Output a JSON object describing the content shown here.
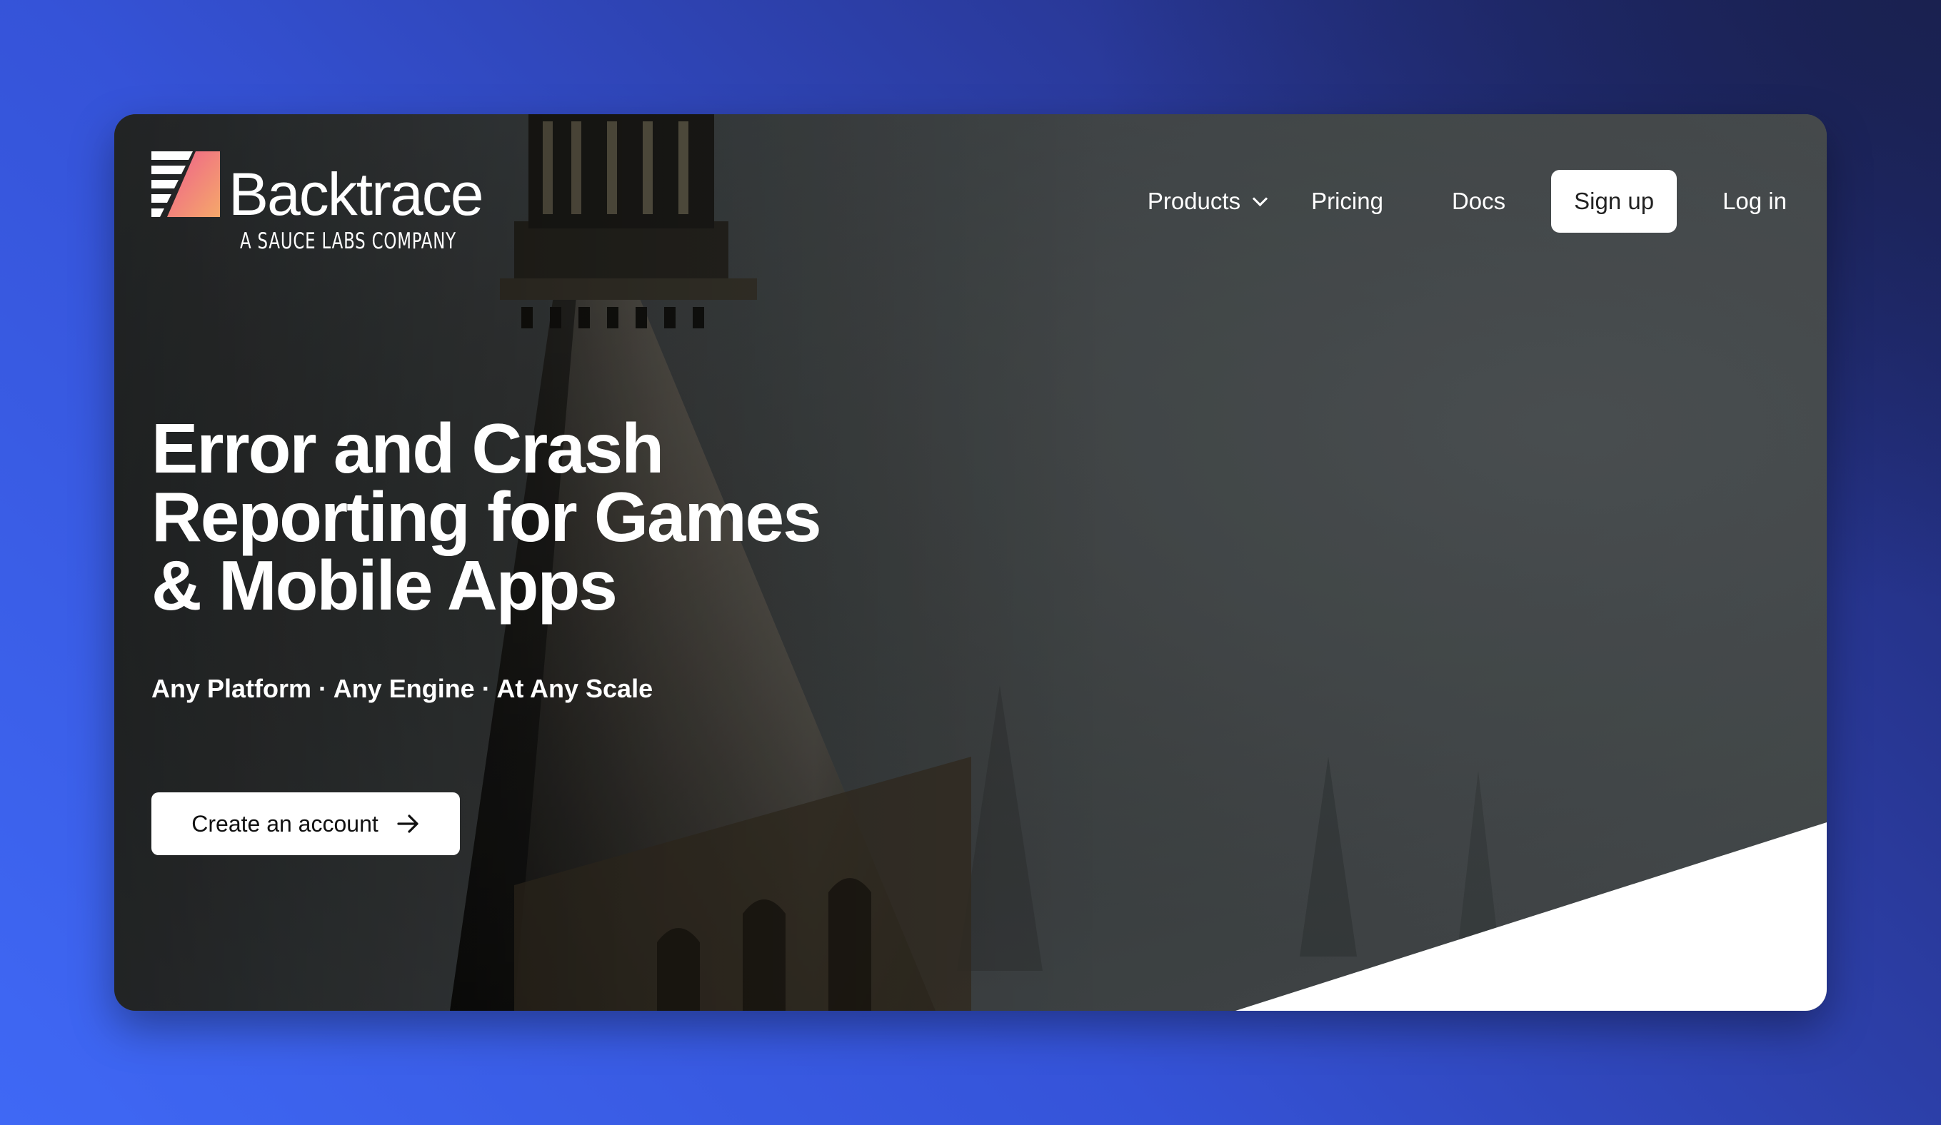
{
  "brand": {
    "name": "Backtrace",
    "tagline": "A SAUCE LABS COMPANY",
    "logo_icon": "backtrace-logo-icon",
    "gradient_start": "#ee5f8c",
    "gradient_end": "#f5a86a"
  },
  "nav": {
    "products_label": "Products",
    "pricing_label": "Pricing",
    "docs_label": "Docs",
    "signup_label": "Sign up",
    "login_label": "Log in"
  },
  "hero": {
    "title_lines": [
      "Error and Crash",
      "Reporting for Games",
      "& Mobile Apps"
    ],
    "subtitle": "Any Platform · Any Engine · At Any Scale",
    "cta_label": "Create an account",
    "cta_icon": "arrow-right-icon"
  },
  "colors": {
    "background_blue": "#3553d8",
    "background_navy": "#1c2566",
    "button_bg": "#ffffff"
  }
}
